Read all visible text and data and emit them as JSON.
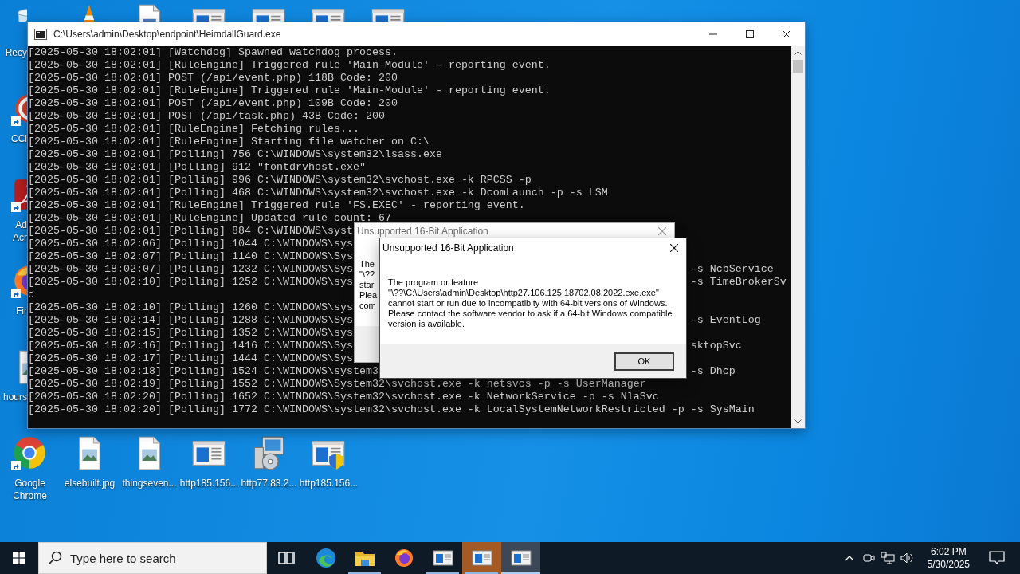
{
  "desktop": {
    "top_icons": [
      {
        "kind": "cone"
      },
      {
        "kind": "document"
      },
      {
        "kind": "window"
      },
      {
        "kind": "window"
      },
      {
        "kind": "window"
      },
      {
        "kind": "window"
      }
    ],
    "left_icons": [
      {
        "kind": "recycle-bin",
        "label": "Recy",
        "shortcut": false
      },
      {
        "kind": "sphere",
        "label": "CCl",
        "shortcut": true
      },
      {
        "kind": "pdf",
        "label": "Ad Acr",
        "shortcut": true
      },
      {
        "kind": "firefox",
        "label": "Fir",
        "shortcut": true
      },
      {
        "kind": "image",
        "label": "hours",
        "shortcut": false
      }
    ],
    "bottom_icons": [
      {
        "kind": "chrome",
        "label": "Google Chrome",
        "shortcut": true
      },
      {
        "kind": "image",
        "label": "elsebuilt.jpg",
        "shortcut": false
      },
      {
        "kind": "image",
        "label": "thingseven...",
        "shortcut": false
      },
      {
        "kind": "window",
        "label": "http185.156...",
        "shortcut": false
      },
      {
        "kind": "installer",
        "label": "http77.83.2...",
        "shortcut": false
      },
      {
        "kind": "window-shield",
        "label": "http185.156...",
        "shortcut": false
      }
    ]
  },
  "console": {
    "title": "C:\\Users\\admin\\Desktop\\endpoint\\HeimdallGuard.exe",
    "lines": [
      {
        "text": "[2025-05-30 18:02:01] [Watchdog] Spawned watchdog process."
      },
      {
        "text": "[2025-05-30 18:02:01] [RuleEngine] Triggered rule 'Main-Module' - reporting event."
      },
      {
        "text": "[2025-05-30 18:02:01] POST (/api/event.php) 118B Code: 200"
      },
      {
        "text": "[2025-05-30 18:02:01] [RuleEngine] Triggered rule 'Main-Module' - reporting event."
      },
      {
        "text": "[2025-05-30 18:02:01] POST (/api/event.php) 109B Code: 200"
      },
      {
        "text": "[2025-05-30 18:02:01] POST (/api/task.php) 43B Code: 200"
      },
      {
        "text": "[2025-05-30 18:02:01] [RuleEngine] Fetching rules..."
      },
      {
        "text": "[2025-05-30 18:02:01] [RuleEngine] Starting file watcher on C:\\"
      },
      {
        "text": "[2025-05-30 18:02:01] [Polling] 756 C:\\WINDOWS\\system32\\lsass.exe"
      },
      {
        "text": "[2025-05-30 18:02:01] [Polling] 912 \"fontdrvhost.exe\""
      },
      {
        "text": "[2025-05-30 18:02:01] [Polling] 996 C:\\WINDOWS\\system32\\svchost.exe -k RPCSS -p"
      },
      {
        "text": "[2025-05-30 18:02:01] [Polling] 468 C:\\WINDOWS\\system32\\svchost.exe -k DcomLaunch -p -s LSM"
      },
      {
        "text": "[2025-05-30 18:02:01] [RuleEngine] Triggered rule 'FS.EXEC' - reporting event."
      },
      {
        "text": "[2025-05-30 18:02:01] [RuleEngine] Updated rule count: 67"
      },
      {
        "text": "[2025-05-30 18:02:01] [Polling] 884 C:\\WINDOWS\\syst"
      },
      {
        "text": "[2025-05-30 18:02:06] [Polling] 1044 C:\\WINDOWS\\sys"
      },
      {
        "text": "[2025-05-30 18:02:07] [Polling] 1140 C:\\WINDOWS\\Sys"
      },
      {
        "text": "[2025-05-30 18:02:07] [Polling] 1232 C:\\WINDOWS\\Sys",
        "tail": "-s NcbService"
      },
      {
        "text": "[2025-05-30 18:02:10] [Polling] 1252 C:\\WINDOWS\\sys",
        "tail": "-s TimeBrokerSv"
      },
      {
        "text": "c"
      },
      {
        "text": "[2025-05-30 18:02:10] [Polling] 1260 C:\\WINDOWS\\sys"
      },
      {
        "text": "[2025-05-30 18:02:14] [Polling] 1288 C:\\WINDOWS\\Sys",
        "tail": "-s EventLog"
      },
      {
        "text": "[2025-05-30 18:02:15] [Polling] 1352 C:\\WINDOWS\\sys"
      },
      {
        "text": "[2025-05-30 18:02:16] [Polling] 1416 C:\\WINDOWS\\Sys",
        "tail": "sktopSvc"
      },
      {
        "text": "[2025-05-30 18:02:17] [Polling] 1444 C:\\WINDOWS\\Sys"
      },
      {
        "text": "[2025-05-30 18:02:18] [Polling] 1524 C:\\WINDOWS\\system3",
        "tail": "-s Dhcp"
      },
      {
        "text": "[2025-05-30 18:02:19] [Polling] 1552 C:\\WINDOWS\\System32\\svchost.exe -k netsvcs -p -s UserManager"
      },
      {
        "text": "[2025-05-30 18:02:20] [Polling] 1652 C:\\WINDOWS\\System32\\svchost.exe -k NetworkService -p -s NlaSvc"
      },
      {
        "text": "[2025-05-30 18:02:20] [Polling] 1772 C:\\WINDOWS\\system32\\svchost.exe -k LocalSystemNetworkRestricted -p -s SysMain"
      }
    ]
  },
  "dialogs": [
    {
      "title": "Unsupported 16-Bit Application",
      "active": false,
      "message_lines": [
        "The",
        "\"\\??",
        "star",
        "Plea",
        "com"
      ]
    },
    {
      "title": "Unsupported 16-Bit Application",
      "active": true,
      "message": "The program or feature \"\\??\\C:\\Users\\admin\\Desktop\\http27.106.125.18702.08.2022.exe.exe\" cannot start or run due to incompatibity with 64-bit versions of Windows. Please contact the software vendor to ask if a 64-bit Windows compatible version is available.",
      "buttons": [
        "OK"
      ]
    }
  ],
  "taskbar": {
    "search": {
      "placeholder": "Type here to search"
    },
    "apps": [
      {
        "kind": "task-view",
        "running": false,
        "attention": false,
        "selected": false
      },
      {
        "kind": "edge",
        "running": false,
        "attention": false,
        "selected": false
      },
      {
        "kind": "folder",
        "running": true,
        "attention": false,
        "selected": false
      },
      {
        "kind": "firefox",
        "running": false,
        "attention": false,
        "selected": false
      },
      {
        "kind": "window",
        "running": true,
        "attention": false,
        "selected": false
      },
      {
        "kind": "window",
        "running": true,
        "attention": true,
        "selected": false
      },
      {
        "kind": "window",
        "running": true,
        "attention": false,
        "selected": true
      }
    ],
    "time": "6:02 PM",
    "date": "5/30/2025"
  }
}
